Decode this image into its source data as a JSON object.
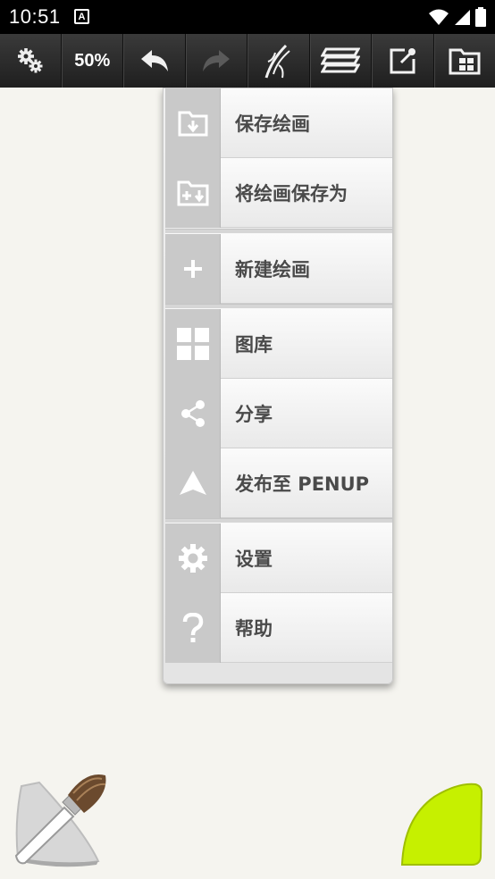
{
  "status_bar": {
    "time": "10:51",
    "notification_glyph": "A",
    "icons": [
      "wifi-icon",
      "signal-icon",
      "battery-icon"
    ]
  },
  "toolbar": {
    "zoom_label": "50%",
    "buttons": [
      "settings-gears-icon",
      "zoom-label",
      "undo-icon",
      "redo-icon",
      "pen-style-icon",
      "layers-icon",
      "export-icon",
      "gallery-icon"
    ]
  },
  "menu": {
    "items": [
      {
        "label": "保存绘画",
        "icon": "folder-save-icon"
      },
      {
        "label": "将绘画保存为",
        "icon": "folder-save-as-icon"
      },
      {
        "label": "新建绘画",
        "icon": "plus-icon"
      },
      {
        "label": "图库",
        "icon": "gallery-grid-icon"
      },
      {
        "label": "分享",
        "icon": "share-icon"
      },
      {
        "label": "发布至 PENUP",
        "icon": "penup-icon"
      },
      {
        "label": "设置",
        "icon": "gear-icon"
      },
      {
        "label": "帮助",
        "icon": "help-icon"
      }
    ]
  },
  "colors": {
    "toolbar_bg": "#2a2a2a",
    "canvas_bg": "#f5f4ef",
    "color_swatch": "#c6f000"
  }
}
